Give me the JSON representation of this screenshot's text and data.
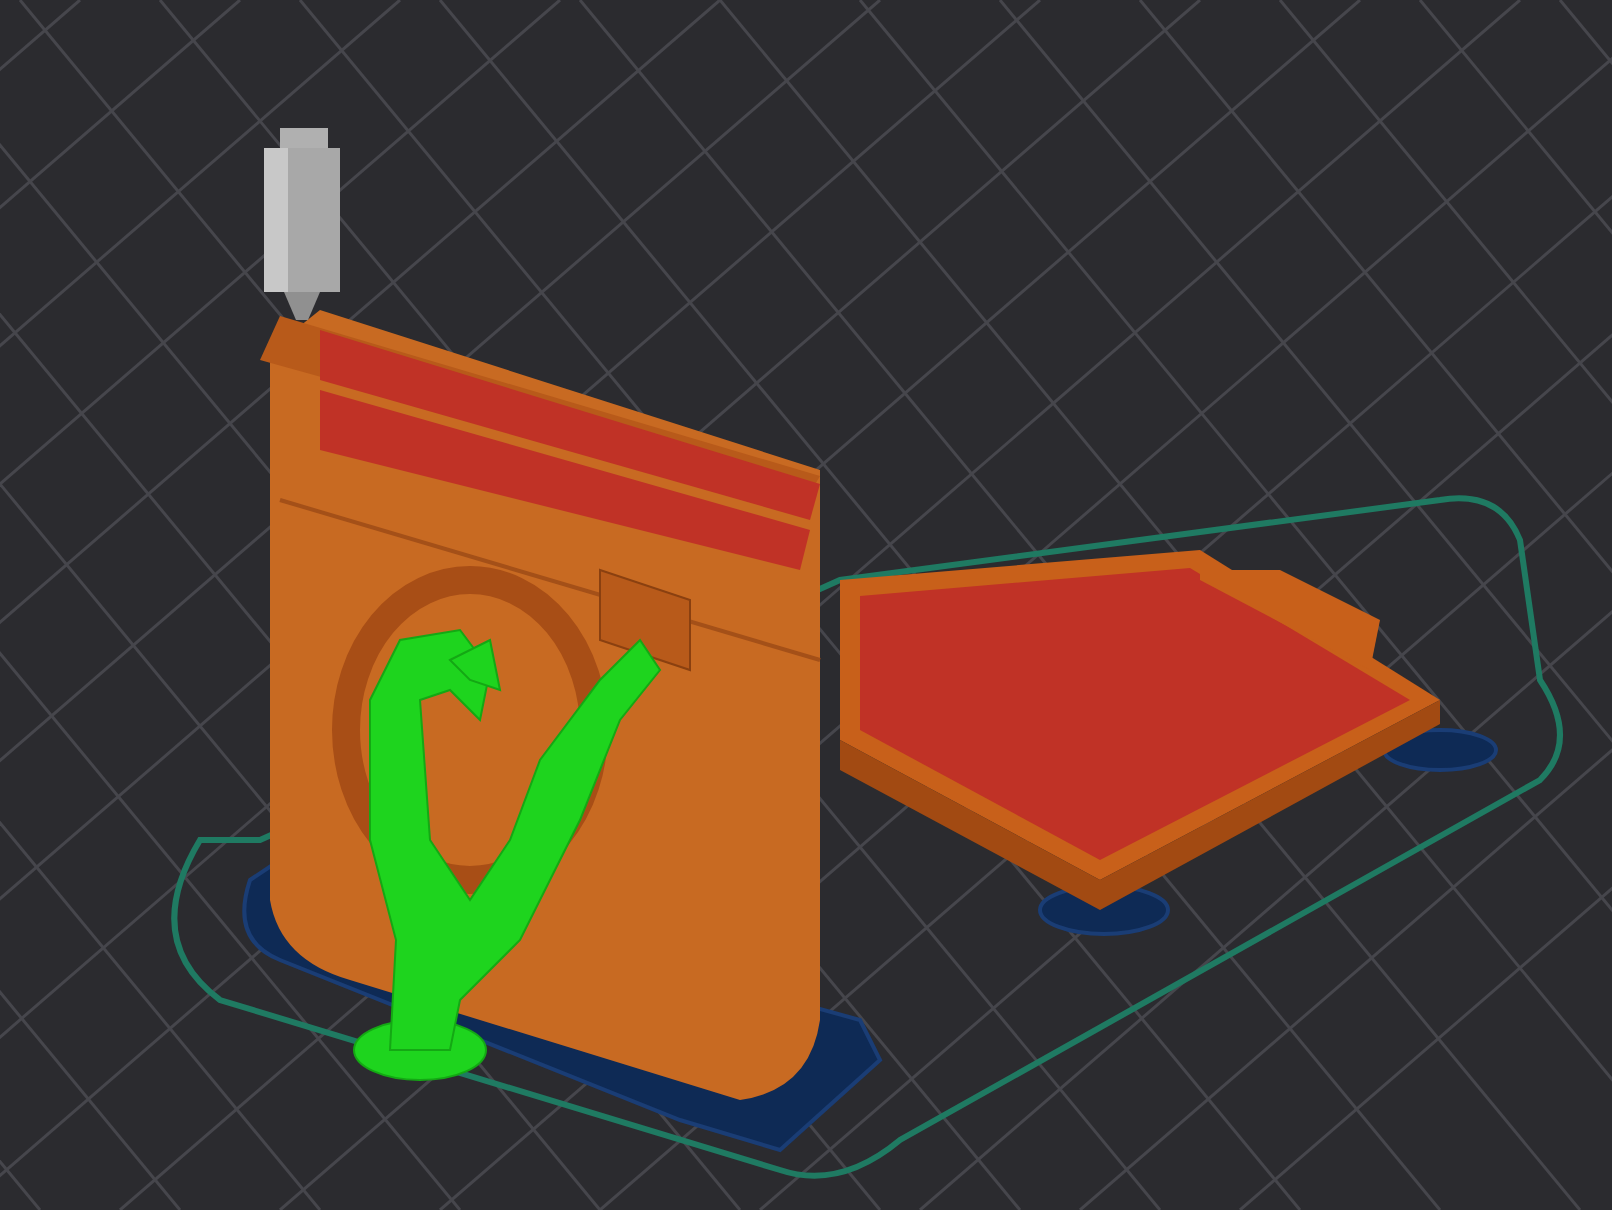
{
  "scene": {
    "kind": "slice-preview"
  }
}
